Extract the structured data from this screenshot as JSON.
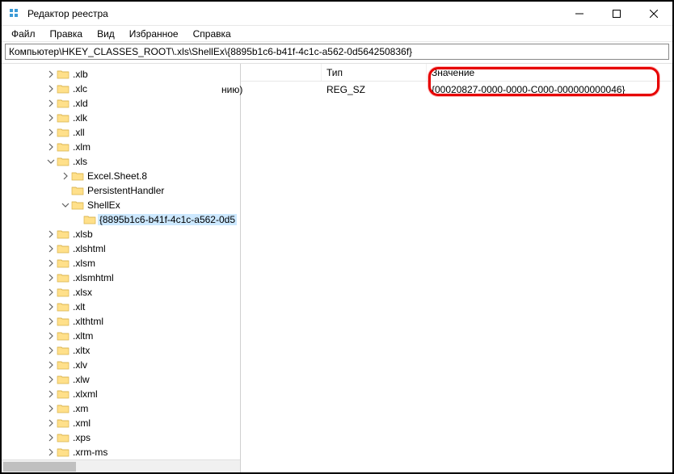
{
  "title": "Редактор реестра",
  "menu": [
    "Файл",
    "Правка",
    "Вид",
    "Избранное",
    "Справка"
  ],
  "address": "Компьютер\\HKEY_CLASSES_ROOT\\.xls\\ShellEx\\{8895b1c6-b41f-4c1c-a562-0d564250836f}",
  "tree": [
    {
      "label": ".xlb",
      "level": 3,
      "exp": "closed"
    },
    {
      "label": ".xlc",
      "level": 3,
      "exp": "closed"
    },
    {
      "label": ".xld",
      "level": 3,
      "exp": "closed"
    },
    {
      "label": ".xlk",
      "level": 3,
      "exp": "closed"
    },
    {
      "label": ".xll",
      "level": 3,
      "exp": "closed"
    },
    {
      "label": ".xlm",
      "level": 3,
      "exp": "closed"
    },
    {
      "label": ".xls",
      "level": 3,
      "exp": "open"
    },
    {
      "label": "Excel.Sheet.8",
      "level": 4,
      "exp": "closed"
    },
    {
      "label": "PersistentHandler",
      "level": 4,
      "exp": "none"
    },
    {
      "label": "ShellEx",
      "level": 4,
      "exp": "open"
    },
    {
      "label": "{8895b1c6-b41f-4c1c-a562-0d5",
      "level": 5,
      "exp": "none",
      "selected": true
    },
    {
      "label": ".xlsb",
      "level": 3,
      "exp": "closed"
    },
    {
      "label": ".xlshtml",
      "level": 3,
      "exp": "closed"
    },
    {
      "label": ".xlsm",
      "level": 3,
      "exp": "closed"
    },
    {
      "label": ".xlsmhtml",
      "level": 3,
      "exp": "closed"
    },
    {
      "label": ".xlsx",
      "level": 3,
      "exp": "closed"
    },
    {
      "label": ".xlt",
      "level": 3,
      "exp": "closed"
    },
    {
      "label": ".xlthtml",
      "level": 3,
      "exp": "closed"
    },
    {
      "label": ".xltm",
      "level": 3,
      "exp": "closed"
    },
    {
      "label": ".xltx",
      "level": 3,
      "exp": "closed"
    },
    {
      "label": ".xlv",
      "level": 3,
      "exp": "closed"
    },
    {
      "label": ".xlw",
      "level": 3,
      "exp": "closed"
    },
    {
      "label": ".xlxml",
      "level": 3,
      "exp": "closed"
    },
    {
      "label": ".xm",
      "level": 3,
      "exp": "closed"
    },
    {
      "label": ".xml",
      "level": 3,
      "exp": "closed"
    },
    {
      "label": ".xps",
      "level": 3,
      "exp": "closed"
    },
    {
      "label": ".xrm-ms",
      "level": 3,
      "exp": "closed"
    }
  ],
  "list": {
    "columns": {
      "type": "Тип",
      "value": "Значение"
    },
    "row": {
      "name_tail": "нию)",
      "type": "REG_SZ",
      "value": "{00020827-0000-0000-C000-000000000046}"
    }
  }
}
